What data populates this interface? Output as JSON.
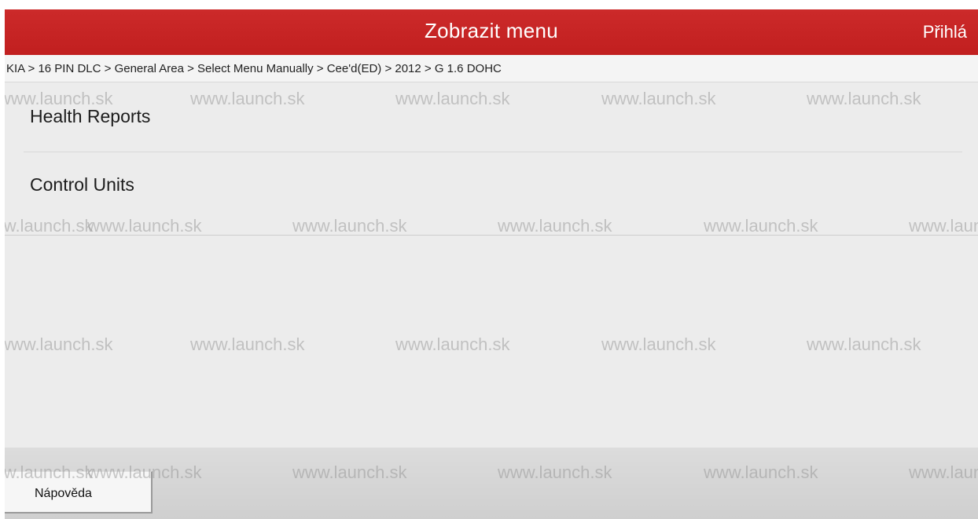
{
  "header": {
    "title": "Zobrazit menu",
    "login_label": "Přihlá"
  },
  "breadcrumb": {
    "text": "KIA > 16 PIN DLC > General Area > Select Menu Manually > Cee'd(ED) > 2012 > G 1.6 DOHC"
  },
  "menu": {
    "items": [
      {
        "label": "Health Reports"
      },
      {
        "label": "Control Units"
      }
    ]
  },
  "footer": {
    "help_label": "Nápověda"
  },
  "watermark": {
    "text": "www.launch.sk"
  },
  "colors": {
    "accent": "#c41e1e",
    "background": "#ececec",
    "footer": "#d6d6d6"
  }
}
